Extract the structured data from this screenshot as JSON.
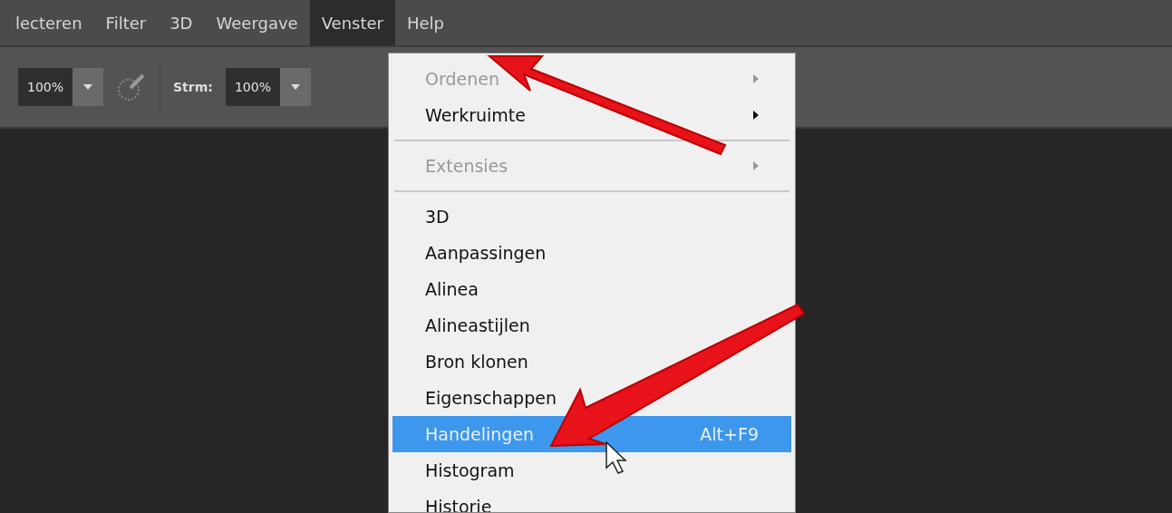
{
  "menu_bar": [
    {
      "label": "lecteren",
      "selected": false
    },
    {
      "label": "Filter",
      "selected": false
    },
    {
      "label": "3D",
      "selected": false
    },
    {
      "label": "Weergave",
      "selected": false
    },
    {
      "label": "Venster",
      "selected": true
    },
    {
      "label": "Help",
      "selected": false
    }
  ],
  "toolbar": {
    "opacity_value": "100%",
    "flow_label": "Strm:",
    "flow_value": "100%"
  },
  "menu": [
    {
      "kind": "submenu",
      "label": "Ordenen",
      "disabled": true,
      "selected": false
    },
    {
      "kind": "submenu",
      "label": "Werkruimte",
      "disabled": false,
      "selected": false
    },
    {
      "kind": "separator"
    },
    {
      "kind": "submenu",
      "label": "Extensies",
      "disabled": true,
      "selected": false
    },
    {
      "kind": "separator"
    },
    {
      "kind": "item",
      "label": "3D",
      "disabled": false,
      "selected": false
    },
    {
      "kind": "item",
      "label": "Aanpassingen",
      "disabled": false,
      "selected": false
    },
    {
      "kind": "item",
      "label": "Alinea",
      "disabled": false,
      "selected": false
    },
    {
      "kind": "item",
      "label": "Alineastijlen",
      "disabled": false,
      "selected": false
    },
    {
      "kind": "item",
      "label": "Bron klonen",
      "disabled": false,
      "selected": false
    },
    {
      "kind": "item",
      "label": "Eigenschappen",
      "disabled": false,
      "selected": false
    },
    {
      "kind": "item",
      "label": "Handelingen",
      "shortcut": "Alt+F9",
      "disabled": false,
      "selected": true
    },
    {
      "kind": "item",
      "label": "Histogram",
      "disabled": false,
      "selected": false
    },
    {
      "kind": "item",
      "label": "Historie",
      "disabled": false,
      "selected": false
    }
  ]
}
